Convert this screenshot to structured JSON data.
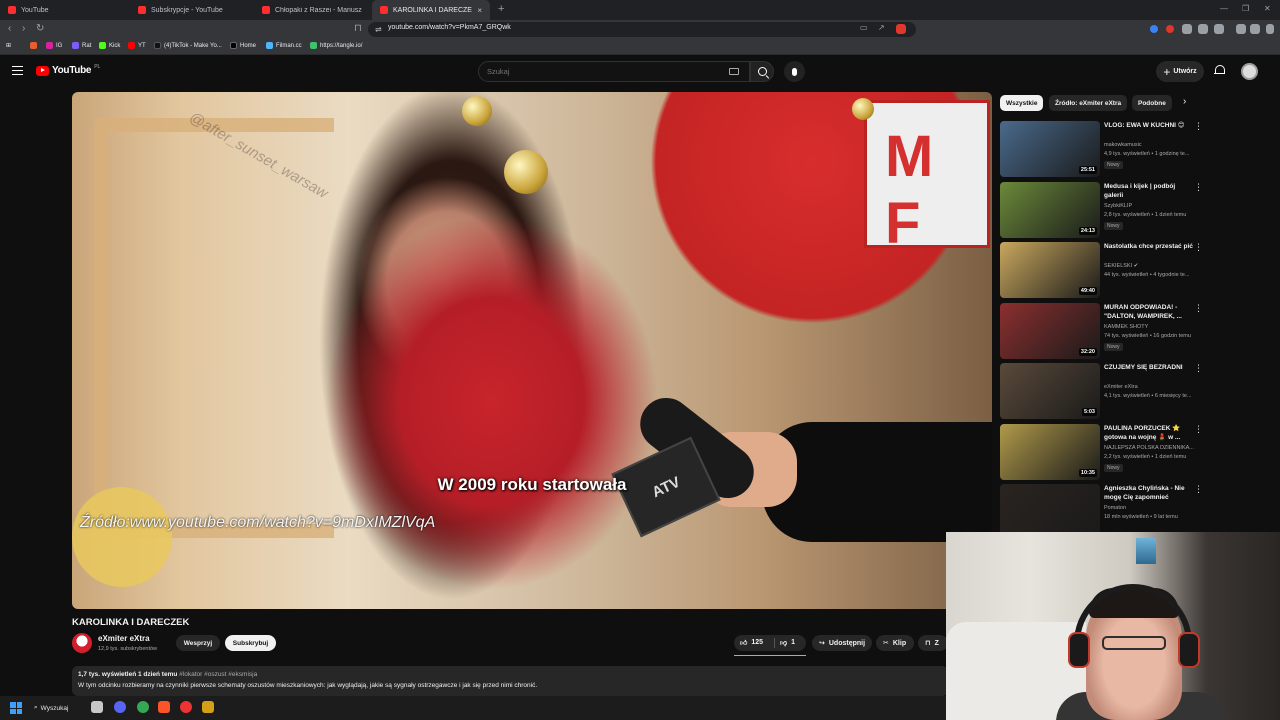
{
  "browser": {
    "tabs": [
      {
        "title": "YouTube"
      },
      {
        "title": "Subskrypcje - YouTube"
      },
      {
        "title": "Chłopaki z Raszei - Mariusz wymyśli"
      },
      {
        "title": "KAROLINKA I DARECZEK - Yo"
      }
    ],
    "new_tab": "+",
    "url": "youtube.com/watch?v=PkmA7_GRQwk",
    "bookmarks": [
      "IG",
      "Rat",
      "Kick",
      "YT",
      "(4)TikTok - Make Yo...",
      "Home",
      "Filman.cc",
      "https://tangle.io/"
    ]
  },
  "youtube": {
    "logo": "YouTube",
    "country": "PL",
    "search_placeholder": "Szukaj",
    "create_label": "Utwórz"
  },
  "video": {
    "subtitle": "W 2009 roku startowała",
    "source_overlay": "Źródło:www.youtube.com/watch?v=9mDxIMZlVqA",
    "sign_text": "M F",
    "mic_logo": "ATV",
    "watermark": "@after_sunset_warsaw",
    "title": "KAROLINKA I DARECZEK",
    "channel": "eXmiter eXtra",
    "subscribers": "12,9 tys. subskrybentów",
    "support_label": "Wesprzyj",
    "subscribe_label": "Subskrybuj",
    "likes": "125",
    "dislikes": "1",
    "share_label": "Udostępnij",
    "clip_label": "Klip",
    "save_label": "Z",
    "desc_meta": "1,7 tys. wyświetleń  1 dzień temu",
    "desc_tags": "#lokator #oszust #eksmisja",
    "desc_text": "W tym odcinku rozbieramy na czynniki pierwsze schematy oszustów mieszkaniowych: jak wyglądają, jakie są sygnały ostrzegawcze i jak się przed nimi chronić."
  },
  "sidebar": {
    "chips": [
      "Wszystkie",
      "Źródło: eXmiter eXtra",
      "Podobne"
    ],
    "recommendations": [
      {
        "title": "VLOG: EWA W KUCHNI 😊",
        "channel": "makowkamusic",
        "meta": "4,9 tys. wyświetleń • 1 godzinę te...",
        "badge": "Nowy",
        "duration": "25:51",
        "color": "#4a6a8c"
      },
      {
        "title": "Medusa i kijek | podbój galerii",
        "channel": "SzybkiKLIP",
        "meta": "2,8 tys. wyświetleń • 1 dzień temu",
        "badge": "Nowy",
        "duration": "24:13",
        "color": "#6b8a3a"
      },
      {
        "title": "Nastolatka chce przestać pić",
        "channel": "SEKIELSKI ✔",
        "meta": "44 tys. wyświetleń • 4 tygodnie te...",
        "badge": "",
        "duration": "49:40",
        "color": "#c9a85e"
      },
      {
        "title": "MURAN ODPOWIADA! - \"DALTON, WAMPIREK, ...",
        "channel": "KAMMEK SHOTY",
        "meta": "74 tys. wyświetleń • 16 godzin temu",
        "badge": "Nowy",
        "duration": "32:20",
        "color": "#8c2f2f"
      },
      {
        "title": "CZUJEMY SIĘ BEZRADNI",
        "channel": "eXmiter eXtra",
        "meta": "4,1 tys. wyświetleń • 6 miesięcy te...",
        "badge": "",
        "duration": "5:03",
        "color": "#5a4a3a"
      },
      {
        "title": "PAULINA PORZUCEK ⭐ gotowa na wojnę 💄 w ...",
        "channel": "NAJLEPSZA POLSKA DZIENNIKA...",
        "meta": "2,2 tys. wyświetleń • 1 dzień temu",
        "badge": "Nowy",
        "duration": "10:35",
        "color": "#b09a4a"
      },
      {
        "title": "Agnieszka Chylińska - Nie mogę Cię zapomnieć",
        "channel": "Pomaton",
        "meta": "18 mln wyświetleń • 9 lat temu",
        "badge": "",
        "duration": "",
        "color": "#2a2420"
      }
    ]
  },
  "taskbar": {
    "search_label": "Wyszukaj"
  }
}
